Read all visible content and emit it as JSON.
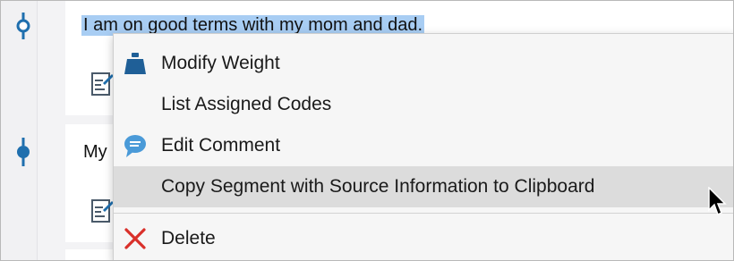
{
  "segments": [
    {
      "text": "I am on good terms with my mom and dad.",
      "selected": true
    },
    {
      "text": "My"
    }
  ],
  "context_menu": {
    "items": [
      {
        "label": "Modify Weight",
        "icon": "weight-icon"
      },
      {
        "label": "List Assigned Codes",
        "icon": ""
      },
      {
        "label": "Edit Comment",
        "icon": "comment-icon"
      },
      {
        "label": "Copy Segment with Source Information to Clipboard",
        "icon": "",
        "hovered": true
      },
      {
        "label": "Delete",
        "icon": "delete-icon"
      }
    ]
  },
  "colors": {
    "selection": "#a8cdf3",
    "marker_blue": "#1f6fae",
    "weight_icon": "#1f5f97",
    "comment_icon": "#4a9ad8",
    "delete_icon": "#d9302a",
    "hover_bg": "#dcdcdc"
  }
}
